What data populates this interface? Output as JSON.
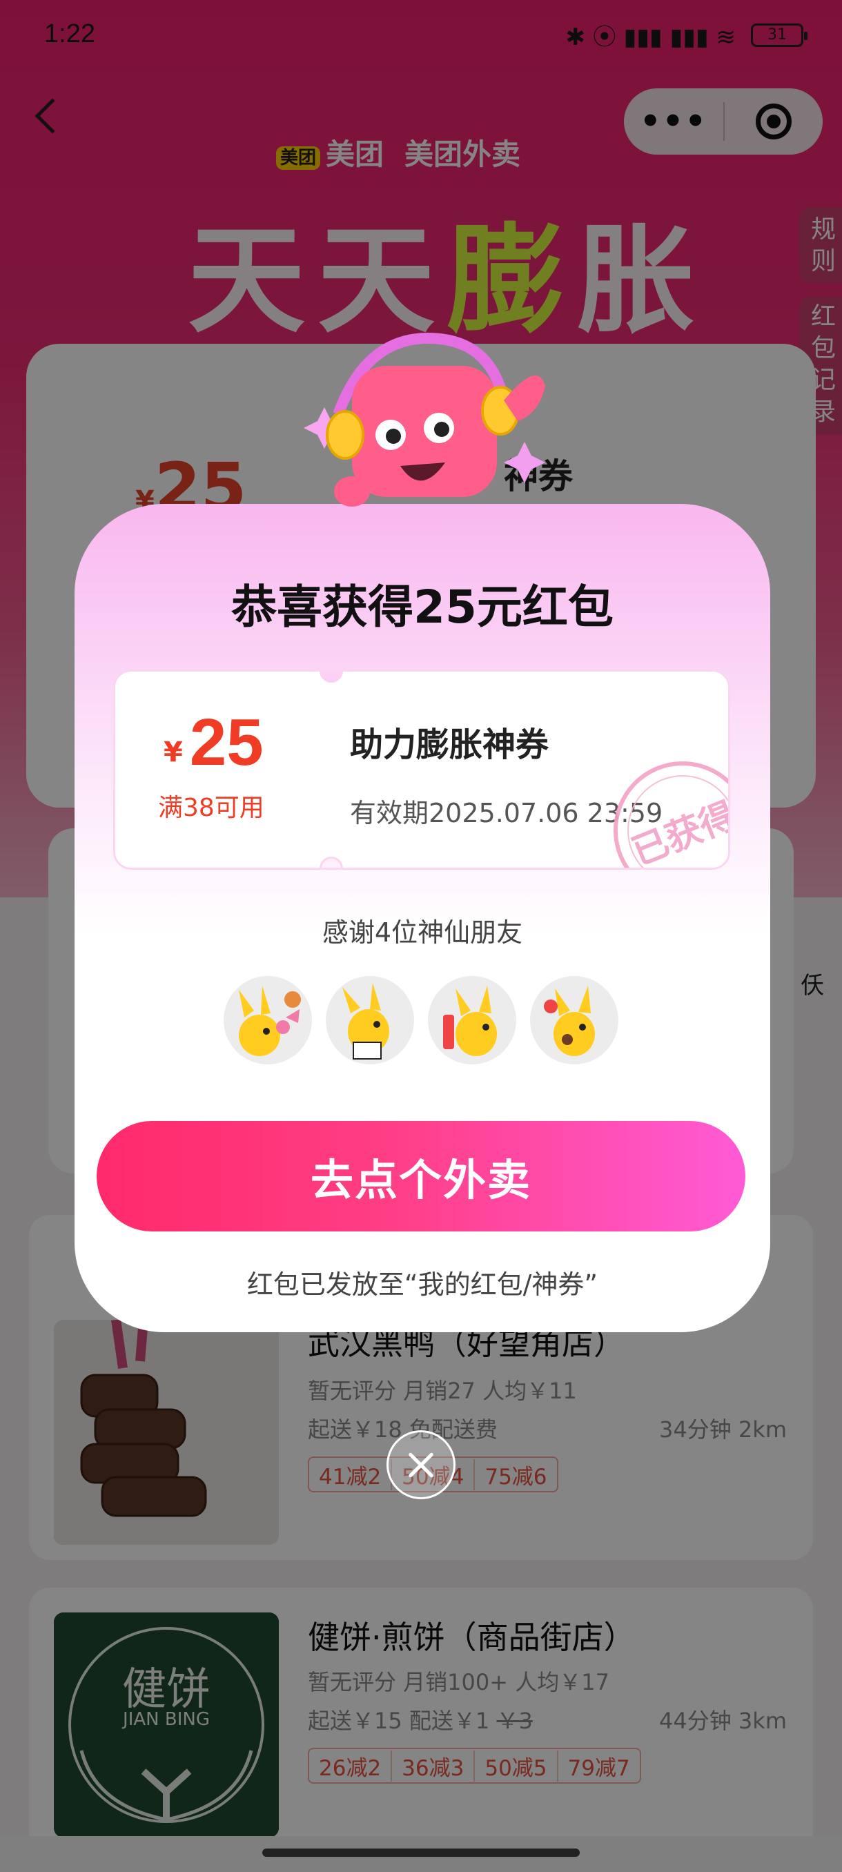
{
  "status_bar": {
    "time": "1:22",
    "battery": "31",
    "signal_icons": "✱ ⦿ ▮▮▮ ▮▮▮ ≋"
  },
  "brand": {
    "meituan_logo": "美团",
    "meituan": "美团",
    "waimai": "美团外卖"
  },
  "banner": {
    "title_pre": "天天",
    "title_hl": "膨",
    "title_post": "胀"
  },
  "side_tabs": {
    "rules": "规则",
    "records": "红包记录"
  },
  "background_card": {
    "amount_symbol": "¥",
    "amount": "25",
    "label_partial": "神券"
  },
  "side_peek": "仸",
  "popup": {
    "title": "恭喜获得25元红包",
    "coupon": {
      "currency": "¥",
      "amount": "25",
      "condition": "满38可用",
      "name": "助力膨胀神券",
      "expiry": "有效期2025.07.06 23:59",
      "stamp": "已获得"
    },
    "thanks": "感谢4位神仙朋友",
    "friends": [
      "friend-1",
      "friend-2",
      "friend-3",
      "friend-4"
    ],
    "cta": "去点个外卖",
    "note": "红包已发放至“我的红包/神券”"
  },
  "shops": [
    {
      "name": "武汉黑鸭（好望角店）",
      "meta": "暂无评分   月销27   人均￥11",
      "delivery": "起送￥18   免配送费",
      "time_dist": "34分钟   2km",
      "tags": [
        "41减2",
        "50减4",
        "75减6"
      ]
    },
    {
      "name": "健饼·煎饼（商品街店）",
      "meta": "暂无评分   月销100+   人均￥17",
      "delivery_a": "起送￥15   配送￥1",
      "delivery_b": "￥3",
      "time_dist": "44分钟   3km",
      "tags": [
        "26减2",
        "36减3",
        "50减5",
        "79减7"
      ],
      "logo_text": "健饼",
      "logo_sub": "JIAN BING"
    }
  ],
  "colors": {
    "brand_pink": "#f0206e",
    "cta_start": "#ff2a6b",
    "cta_end": "#ff5bd6",
    "price_red": "#f03c24"
  }
}
